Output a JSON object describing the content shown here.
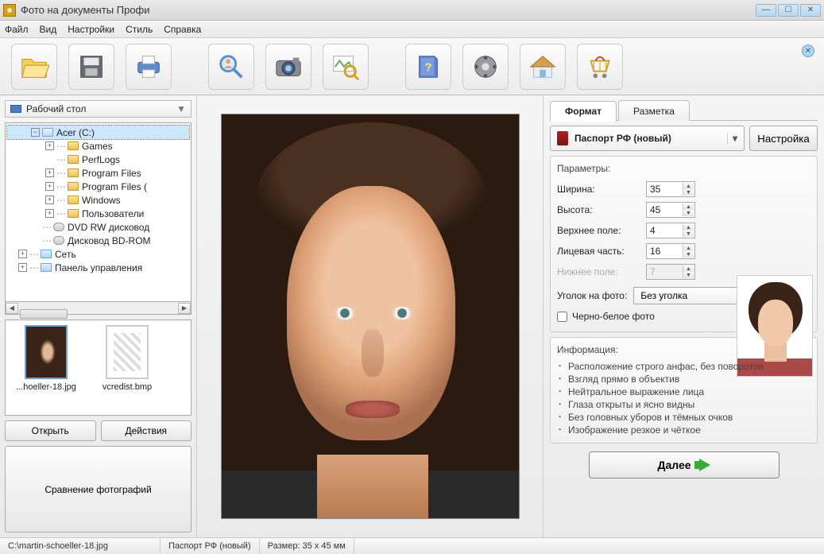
{
  "app": {
    "title": "Фото на документы Профи"
  },
  "menu": {
    "file": "Файл",
    "view": "Вид",
    "settings": "Настройки",
    "style": "Стиль",
    "help": "Справка"
  },
  "toolbar_icons": [
    "open",
    "save",
    "print",
    "zoom-user",
    "camera",
    "search-image",
    "help-book",
    "media",
    "home",
    "cart"
  ],
  "sidebar": {
    "location": "Рабочий стол",
    "tree": {
      "acer": "Acer (C:)",
      "games": "Games",
      "perflogs": "PerfLogs",
      "progfiles": "Program Files",
      "progfilesx": "Program Files (",
      "windows": "Windows",
      "users": "Пользователи",
      "dvd": "DVD RW дисковод",
      "bd": "Дисковод BD-ROM",
      "network": "Сеть",
      "ctrlpanel": "Панель управления"
    },
    "thumbs": {
      "file1": "...hoeller-18.jpg",
      "file2": "vcredist.bmp"
    },
    "open_btn": "Открыть",
    "actions_btn": "Действия",
    "compare_btn": "Сравнение фотографий"
  },
  "right": {
    "tab_format": "Формат",
    "tab_layout": "Разметка",
    "format_name": "Паспорт РФ (новый)",
    "configure": "Настройка",
    "params_title": "Параметры:",
    "p_width": "Ширина:",
    "p_height": "Высота:",
    "p_top": "Верхнее поле:",
    "p_face": "Лицевая часть:",
    "p_bottom": "Нижнее поле:",
    "v_width": "35",
    "v_height": "45",
    "v_top": "4",
    "v_face": "16",
    "v_bottom": "7",
    "corner_lbl": "Уголок на фото:",
    "corner_val": "Без уголка",
    "bw": "Черно-белое фото",
    "info_title": "Информация:",
    "info": [
      "Расположение строго анфас, без поворотов",
      "Взгляд прямо в объектив",
      "Нейтральное выражение лица",
      "Глаза открыты и ясно видны",
      "Без головных уборов и тёмных очков",
      "Изображение резкое и чёткое"
    ],
    "next": "Далее"
  },
  "status": {
    "path": "C:\\martin-schoeller-18.jpg",
    "format": "Паспорт РФ (новый)",
    "size": "Размер: 35 x 45 мм"
  }
}
